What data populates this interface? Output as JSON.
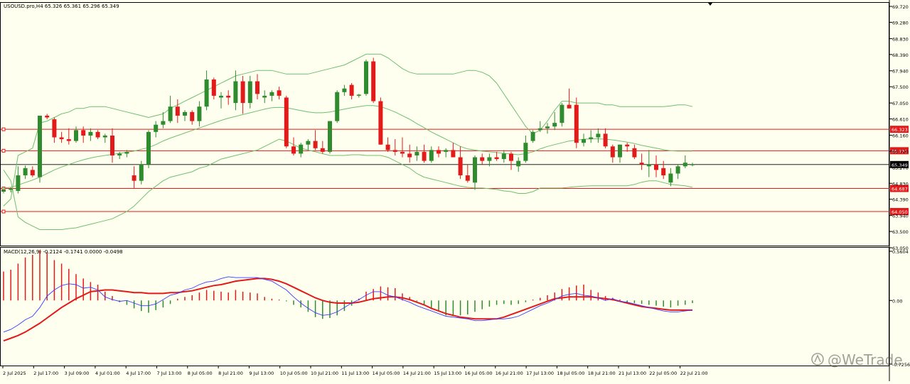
{
  "window": {
    "symbol_header": "USOUSD.pro,H4  65.326 65.361 65.296 65.349",
    "macd_header": "MACD(12,26,9) -0.2124 -0.1741 0.0000 -0.0498",
    "watermark": "@WeTrade"
  },
  "colors": {
    "background": "#fffff0",
    "bull_candle": "#2e8b2e",
    "bear_candle": "#e31a1a",
    "bands": "#6fbf6f",
    "macd_line": "#3a3aff",
    "signal_line": "#e31a1a",
    "level_line": "#e31a1a",
    "current_price_line": "#000000"
  },
  "price_axis": {
    "ticks": [
      "69.720",
      "69.280",
      "68.830",
      "68.390",
      "67.940",
      "67.500",
      "67.050",
      "66.610",
      "66.160",
      "65.720",
      "65.270",
      "64.830",
      "64.390",
      "63.940",
      "63.500",
      "63.050"
    ],
    "min": 63.05,
    "max": 69.72
  },
  "macd_axis": {
    "ticks": [
      "0.5604",
      "0.00",
      "-0.7256"
    ],
    "min": -0.7256,
    "max": 0.5604
  },
  "levels": [
    {
      "value": 66.323,
      "label": "66.323"
    },
    {
      "value": 65.731,
      "label": "65.731"
    },
    {
      "value": 64.687,
      "label": "64.687"
    },
    {
      "value": 64.05,
      "label": "64.050"
    }
  ],
  "current_price": {
    "value": 65.349,
    "label": "65.349"
  },
  "time_axis": [
    "2 Jul 2025",
    "2 Jul 17:00",
    "3 Jul 09:00",
    "4 Jul 01:00",
    "4 Jul 17:00",
    "7 Jul 13:00",
    "8 Jul 05:00",
    "8 Jul 21:00",
    "9 Jul 13:00",
    "10 Jul 05:00",
    "10 Jul 21:00",
    "11 Jul 13:00",
    "14 Jul 05:00",
    "14 Jul 21:00",
    "15 Jul 13:00",
    "16 Jul 05:00",
    "16 Jul 21:00",
    "17 Jul 13:00",
    "18 Jul 05:00",
    "18 Jul 21:00",
    "21 Jul 13:00",
    "22 Jul 05:00",
    "22 Jul 21:00"
  ],
  "chart_data": {
    "type": "candlestick",
    "symbol": "USOUSD.pro",
    "timeframe": "H4",
    "candles": [
      [
        64.6,
        64.7,
        64.55,
        64.65
      ],
      [
        64.65,
        64.72,
        64.58,
        64.68
      ],
      [
        64.62,
        65.3,
        64.55,
        65.05
      ],
      [
        65.05,
        65.32,
        64.95,
        65.25
      ],
      [
        65.2,
        65.3,
        65.0,
        65.05
      ],
      [
        65.0,
        66.7,
        64.85,
        66.7
      ],
      [
        66.7,
        66.75,
        66.6,
        66.65
      ],
      [
        66.6,
        66.65,
        65.95,
        66.1
      ],
      [
        66.1,
        66.25,
        65.95,
        66.05
      ],
      [
        66.05,
        66.35,
        65.9,
        66.0
      ],
      [
        66.0,
        66.4,
        65.95,
        66.3
      ],
      [
        66.3,
        66.4,
        65.95,
        66.15
      ],
      [
        66.15,
        66.35,
        66.0,
        66.25
      ],
      [
        66.25,
        66.3,
        66.05,
        66.1
      ],
      [
        66.1,
        66.2,
        65.95,
        66.15
      ],
      [
        66.15,
        66.35,
        65.4,
        65.6
      ],
      [
        65.6,
        65.7,
        65.5,
        65.65
      ],
      [
        65.65,
        65.75,
        65.55,
        65.7
      ],
      [
        65.05,
        65.3,
        64.7,
        64.9
      ],
      [
        64.9,
        65.45,
        64.8,
        65.35
      ],
      [
        65.35,
        66.3,
        65.25,
        66.25
      ],
      [
        66.25,
        66.55,
        66.1,
        66.45
      ],
      [
        66.45,
        66.8,
        66.35,
        66.55
      ],
      [
        66.55,
        67.25,
        66.5,
        66.95
      ],
      [
        66.95,
        67.15,
        66.5,
        66.7
      ],
      [
        66.7,
        66.85,
        66.55,
        66.8
      ],
      [
        66.8,
        66.85,
        66.45,
        66.55
      ],
      [
        66.55,
        67.1,
        66.4,
        66.95
      ],
      [
        66.95,
        67.95,
        66.85,
        67.7
      ],
      [
        67.7,
        67.75,
        67.15,
        67.25
      ],
      [
        67.2,
        67.35,
        66.9,
        67.25
      ],
      [
        67.25,
        67.4,
        67.0,
        67.2
      ],
      [
        67.05,
        67.95,
        66.85,
        67.65
      ],
      [
        67.65,
        67.8,
        66.75,
        67.05
      ],
      [
        67.05,
        67.8,
        66.9,
        67.65
      ],
      [
        67.65,
        67.85,
        67.15,
        67.3
      ],
      [
        67.2,
        67.4,
        67.05,
        67.25
      ],
      [
        67.25,
        67.4,
        67.1,
        67.35
      ],
      [
        67.4,
        67.5,
        67.15,
        67.25
      ],
      [
        67.2,
        67.25,
        65.8,
        65.85
      ],
      [
        65.85,
        66.1,
        65.6,
        65.65
      ],
      [
        65.65,
        65.95,
        65.55,
        65.9
      ],
      [
        65.9,
        66.05,
        65.75,
        66.0
      ],
      [
        66.0,
        66.3,
        65.75,
        65.8
      ],
      [
        65.8,
        66.0,
        65.65,
        65.7
      ],
      [
        65.7,
        66.55,
        65.65,
        66.55
      ],
      [
        66.55,
        67.4,
        66.5,
        67.35
      ],
      [
        67.35,
        67.55,
        67.25,
        67.45
      ],
      [
        67.55,
        67.6,
        67.15,
        67.25
      ],
      [
        67.25,
        67.3,
        67.2,
        67.28
      ],
      [
        67.3,
        68.25,
        67.25,
        68.2
      ],
      [
        68.2,
        68.3,
        67.05,
        67.1
      ],
      [
        67.1,
        67.2,
        65.9,
        65.9
      ],
      [
        65.9,
        66.1,
        65.7,
        65.75
      ],
      [
        65.75,
        66.05,
        65.6,
        65.7
      ],
      [
        65.7,
        66.1,
        65.55,
        65.65
      ],
      [
        65.65,
        65.9,
        65.4,
        65.55
      ],
      [
        65.6,
        65.85,
        65.45,
        65.7
      ],
      [
        65.7,
        65.9,
        65.4,
        65.45
      ],
      [
        65.45,
        65.85,
        65.4,
        65.75
      ],
      [
        65.75,
        65.85,
        65.55,
        65.65
      ],
      [
        65.7,
        65.8,
        65.55,
        65.75
      ],
      [
        65.75,
        65.95,
        65.55,
        65.55
      ],
      [
        65.55,
        65.85,
        64.95,
        65.05
      ],
      [
        65.05,
        65.35,
        64.85,
        64.9
      ],
      [
        64.85,
        65.6,
        64.65,
        65.55
      ],
      [
        65.55,
        65.65,
        65.35,
        65.45
      ],
      [
        65.45,
        65.65,
        65.3,
        65.55
      ],
      [
        65.55,
        65.7,
        65.45,
        65.5
      ],
      [
        65.5,
        65.75,
        65.4,
        65.65
      ],
      [
        65.65,
        65.7,
        65.2,
        65.45
      ],
      [
        65.3,
        65.55,
        65.15,
        65.45
      ],
      [
        65.45,
        66.15,
        65.4,
        65.95
      ],
      [
        66.0,
        66.3,
        65.95,
        66.25
      ],
      [
        66.3,
        66.55,
        66.25,
        66.35
      ],
      [
        66.35,
        66.5,
        66.2,
        66.4
      ],
      [
        66.4,
        66.8,
        66.3,
        66.5
      ],
      [
        66.5,
        67.05,
        66.4,
        67.0
      ],
      [
        67.0,
        67.45,
        66.9,
        66.9
      ],
      [
        67.0,
        67.2,
        65.8,
        65.95
      ],
      [
        65.95,
        66.2,
        65.85,
        66.05
      ],
      [
        66.05,
        66.3,
        65.95,
        66.1
      ],
      [
        66.1,
        66.35,
        65.95,
        66.2
      ],
      [
        66.2,
        66.35,
        65.8,
        65.85
      ],
      [
        65.85,
        65.9,
        65.4,
        65.55
      ],
      [
        65.55,
        65.9,
        65.4,
        65.9
      ],
      [
        65.9,
        65.95,
        65.7,
        65.85
      ],
      [
        65.8,
        65.9,
        65.5,
        65.55
      ],
      [
        65.4,
        65.65,
        65.2,
        65.35
      ],
      [
        65.3,
        65.75,
        65.0,
        65.35
      ],
      [
        65.35,
        65.6,
        65.0,
        65.2
      ],
      [
        65.25,
        65.45,
        64.95,
        65.05
      ],
      [
        64.85,
        65.25,
        64.75,
        65.1
      ],
      [
        65.1,
        65.35,
        64.95,
        65.3
      ],
      [
        65.3,
        65.6,
        65.25,
        65.4
      ],
      [
        65.35,
        65.4,
        65.3,
        65.35
      ]
    ],
    "bands": {
      "upper": [
        64.2,
        64.4,
        65.6,
        65.7,
        65.8,
        66.5,
        66.55,
        66.65,
        66.75,
        66.8,
        66.9,
        66.9,
        66.95,
        66.95,
        66.95,
        66.9,
        66.85,
        66.8,
        66.75,
        66.7,
        66.65,
        66.7,
        66.75,
        66.9,
        67.0,
        67.1,
        67.2,
        67.3,
        67.4,
        67.5,
        67.6,
        67.7,
        67.8,
        67.85,
        67.9,
        67.95,
        67.95,
        67.95,
        67.9,
        67.85,
        67.85,
        67.85,
        67.85,
        67.9,
        67.95,
        68.0,
        68.05,
        68.1,
        68.2,
        68.3,
        68.4,
        68.4,
        68.4,
        68.3,
        68.15,
        68.0,
        67.9,
        67.85,
        67.85,
        67.85,
        67.85,
        67.85,
        67.85,
        67.9,
        67.95,
        67.95,
        67.9,
        67.8,
        67.6,
        67.3,
        67.0,
        66.7,
        66.4,
        66.2,
        66.3,
        66.55,
        66.85,
        67.1,
        67.1,
        67.05,
        67.05,
        67.05,
        67.05,
        67.0,
        67.0,
        66.95,
        66.95,
        66.95,
        66.95,
        66.95,
        66.95,
        66.95,
        66.97,
        67.0,
        67.0,
        66.95
      ],
      "middle": [
        64.7,
        64.72,
        64.78,
        64.85,
        64.92,
        65.0,
        65.1,
        65.2,
        65.28,
        65.35,
        65.42,
        65.48,
        65.53,
        65.57,
        65.6,
        65.63,
        65.66,
        65.69,
        65.72,
        65.77,
        65.82,
        65.9,
        66.0,
        66.08,
        66.15,
        66.22,
        66.29,
        66.36,
        66.43,
        66.5,
        66.57,
        66.63,
        66.68,
        66.73,
        66.78,
        66.83,
        66.88,
        66.92,
        66.93,
        66.92,
        66.88,
        66.84,
        66.8,
        66.78,
        66.78,
        66.8,
        66.84,
        66.88,
        66.92,
        66.95,
        66.98,
        66.98,
        66.95,
        66.88,
        66.8,
        66.7,
        66.6,
        66.48,
        66.37,
        66.25,
        66.15,
        66.05,
        65.95,
        65.85,
        65.78,
        65.75,
        65.72,
        65.7,
        65.68,
        65.66,
        65.64,
        65.62,
        65.65,
        65.7,
        65.78,
        65.85,
        65.9,
        65.95,
        66.0,
        66.02,
        66.05,
        66.06,
        66.06,
        66.05,
        66.03,
        66.0,
        65.97,
        65.93,
        65.88,
        65.84,
        65.8,
        65.76,
        65.73,
        65.72,
        65.72,
        65.72
      ],
      "lower": [
        65.2,
        64.9,
        63.9,
        63.75,
        63.65,
        63.55,
        63.55,
        63.55,
        63.55,
        63.58,
        63.6,
        63.65,
        63.7,
        63.75,
        63.8,
        63.85,
        63.95,
        64.05,
        64.2,
        64.4,
        64.6,
        64.75,
        64.9,
        65.0,
        65.05,
        65.1,
        65.15,
        65.25,
        65.3,
        65.4,
        65.5,
        65.55,
        65.6,
        65.65,
        65.7,
        65.75,
        65.85,
        65.95,
        66.05,
        66.0,
        65.9,
        65.8,
        65.75,
        65.7,
        65.65,
        65.6,
        65.6,
        65.6,
        65.62,
        65.62,
        65.6,
        65.6,
        65.6,
        65.55,
        65.45,
        65.35,
        65.25,
        65.1,
        65.0,
        64.95,
        64.9,
        64.85,
        64.8,
        64.75,
        64.72,
        64.7,
        64.7,
        64.68,
        64.66,
        64.62,
        64.6,
        64.55,
        64.55,
        64.6,
        64.7,
        64.7,
        64.7,
        64.7,
        64.72,
        64.74,
        64.75,
        64.76,
        64.76,
        64.76,
        64.76,
        64.76,
        64.76,
        64.8,
        64.86,
        64.9,
        64.9,
        64.85,
        64.8,
        64.78,
        64.76,
        64.72
      ]
    },
    "macd": {
      "histogram": [
        0.33,
        0.35,
        0.42,
        0.49,
        0.52,
        0.57,
        0.55,
        0.46,
        0.42,
        0.36,
        0.3,
        0.25,
        0.21,
        0.18,
        0.1,
        0.05,
        -0.02,
        -0.05,
        -0.09,
        -0.12,
        -0.14,
        -0.11,
        -0.08,
        -0.04,
        0.02,
        0.04,
        0.06,
        0.09,
        0.12,
        0.11,
        0.1,
        0.09,
        0.12,
        0.1,
        0.09,
        0.08,
        0.04,
        0.02,
        0.01,
        -0.01,
        -0.05,
        -0.08,
        -0.13,
        -0.19,
        -0.21,
        -0.2,
        -0.17,
        -0.12,
        -0.06,
        0.02,
        0.1,
        0.13,
        0.16,
        0.15,
        0.14,
        0.08,
        0.04,
        -0.01,
        -0.05,
        -0.09,
        -0.12,
        -0.17,
        -0.18,
        -0.17,
        -0.16,
        -0.13,
        -0.1,
        -0.07,
        -0.05,
        -0.04,
        -0.05,
        -0.04,
        -0.02,
        0.01,
        0.03,
        0.06,
        0.09,
        0.13,
        0.15,
        0.17,
        0.18,
        0.12,
        0.09,
        0.05,
        0.03,
        0.01,
        -0.02,
        -0.03,
        -0.04,
        -0.05,
        -0.06,
        -0.07,
        -0.08,
        -0.06,
        -0.05,
        -0.03
      ],
      "macd_line": [
        -0.36,
        -0.33,
        -0.28,
        -0.22,
        -0.18,
        -0.08,
        0.05,
        0.12,
        0.17,
        0.19,
        0.18,
        0.14,
        0.15,
        0.12,
        0.04,
        0.01,
        -0.01,
        0.0,
        -0.03,
        -0.06,
        -0.06,
        -0.04,
        0.01,
        0.06,
        0.08,
        0.12,
        0.14,
        0.18,
        0.21,
        0.22,
        0.25,
        0.27,
        0.26,
        0.26,
        0.26,
        0.26,
        0.24,
        0.22,
        0.17,
        0.12,
        0.04,
        -0.03,
        -0.09,
        -0.14,
        -0.17,
        -0.16,
        -0.13,
        -0.08,
        -0.03,
        0.01,
        0.06,
        0.1,
        0.1,
        0.06,
        0.04,
        0.01,
        -0.02,
        -0.06,
        -0.09,
        -0.12,
        -0.15,
        -0.18,
        -0.19,
        -0.2,
        -0.21,
        -0.23,
        -0.23,
        -0.22,
        -0.21,
        -0.21,
        -0.2,
        -0.18,
        -0.14,
        -0.1,
        -0.06,
        -0.03,
        0.01,
        0.05,
        0.07,
        0.08,
        0.06,
        0.05,
        0.03,
        0.0,
        0.02,
        -0.01,
        -0.02,
        -0.04,
        -0.06,
        -0.08,
        -0.1,
        -0.12,
        -0.13,
        -0.13,
        -0.12,
        -0.11
      ],
      "signal_line": [
        -0.46,
        -0.43,
        -0.4,
        -0.36,
        -0.31,
        -0.26,
        -0.2,
        -0.14,
        -0.08,
        -0.03,
        0.02,
        0.06,
        0.1,
        0.11,
        0.12,
        0.12,
        0.11,
        0.1,
        0.09,
        0.09,
        0.08,
        0.08,
        0.08,
        0.09,
        0.09,
        0.1,
        0.11,
        0.13,
        0.15,
        0.17,
        0.18,
        0.2,
        0.22,
        0.23,
        0.24,
        0.25,
        0.25,
        0.24,
        0.22,
        0.19,
        0.15,
        0.11,
        0.07,
        0.03,
        0.0,
        -0.02,
        -0.03,
        -0.03,
        -0.03,
        -0.02,
        0.0,
        0.02,
        0.03,
        0.04,
        0.04,
        0.03,
        0.01,
        -0.02,
        -0.05,
        -0.09,
        -0.12,
        -0.15,
        -0.17,
        -0.19,
        -0.2,
        -0.21,
        -0.21,
        -0.21,
        -0.21,
        -0.19,
        -0.16,
        -0.13,
        -0.1,
        -0.07,
        -0.04,
        -0.01,
        0.02,
        0.03,
        0.04,
        0.04,
        0.04,
        0.04,
        0.03,
        0.02,
        0.01,
        -0.01,
        -0.03,
        -0.05,
        -0.07,
        -0.08,
        -0.09,
        -0.1,
        -0.11,
        -0.11,
        -0.11,
        -0.11
      ]
    }
  }
}
